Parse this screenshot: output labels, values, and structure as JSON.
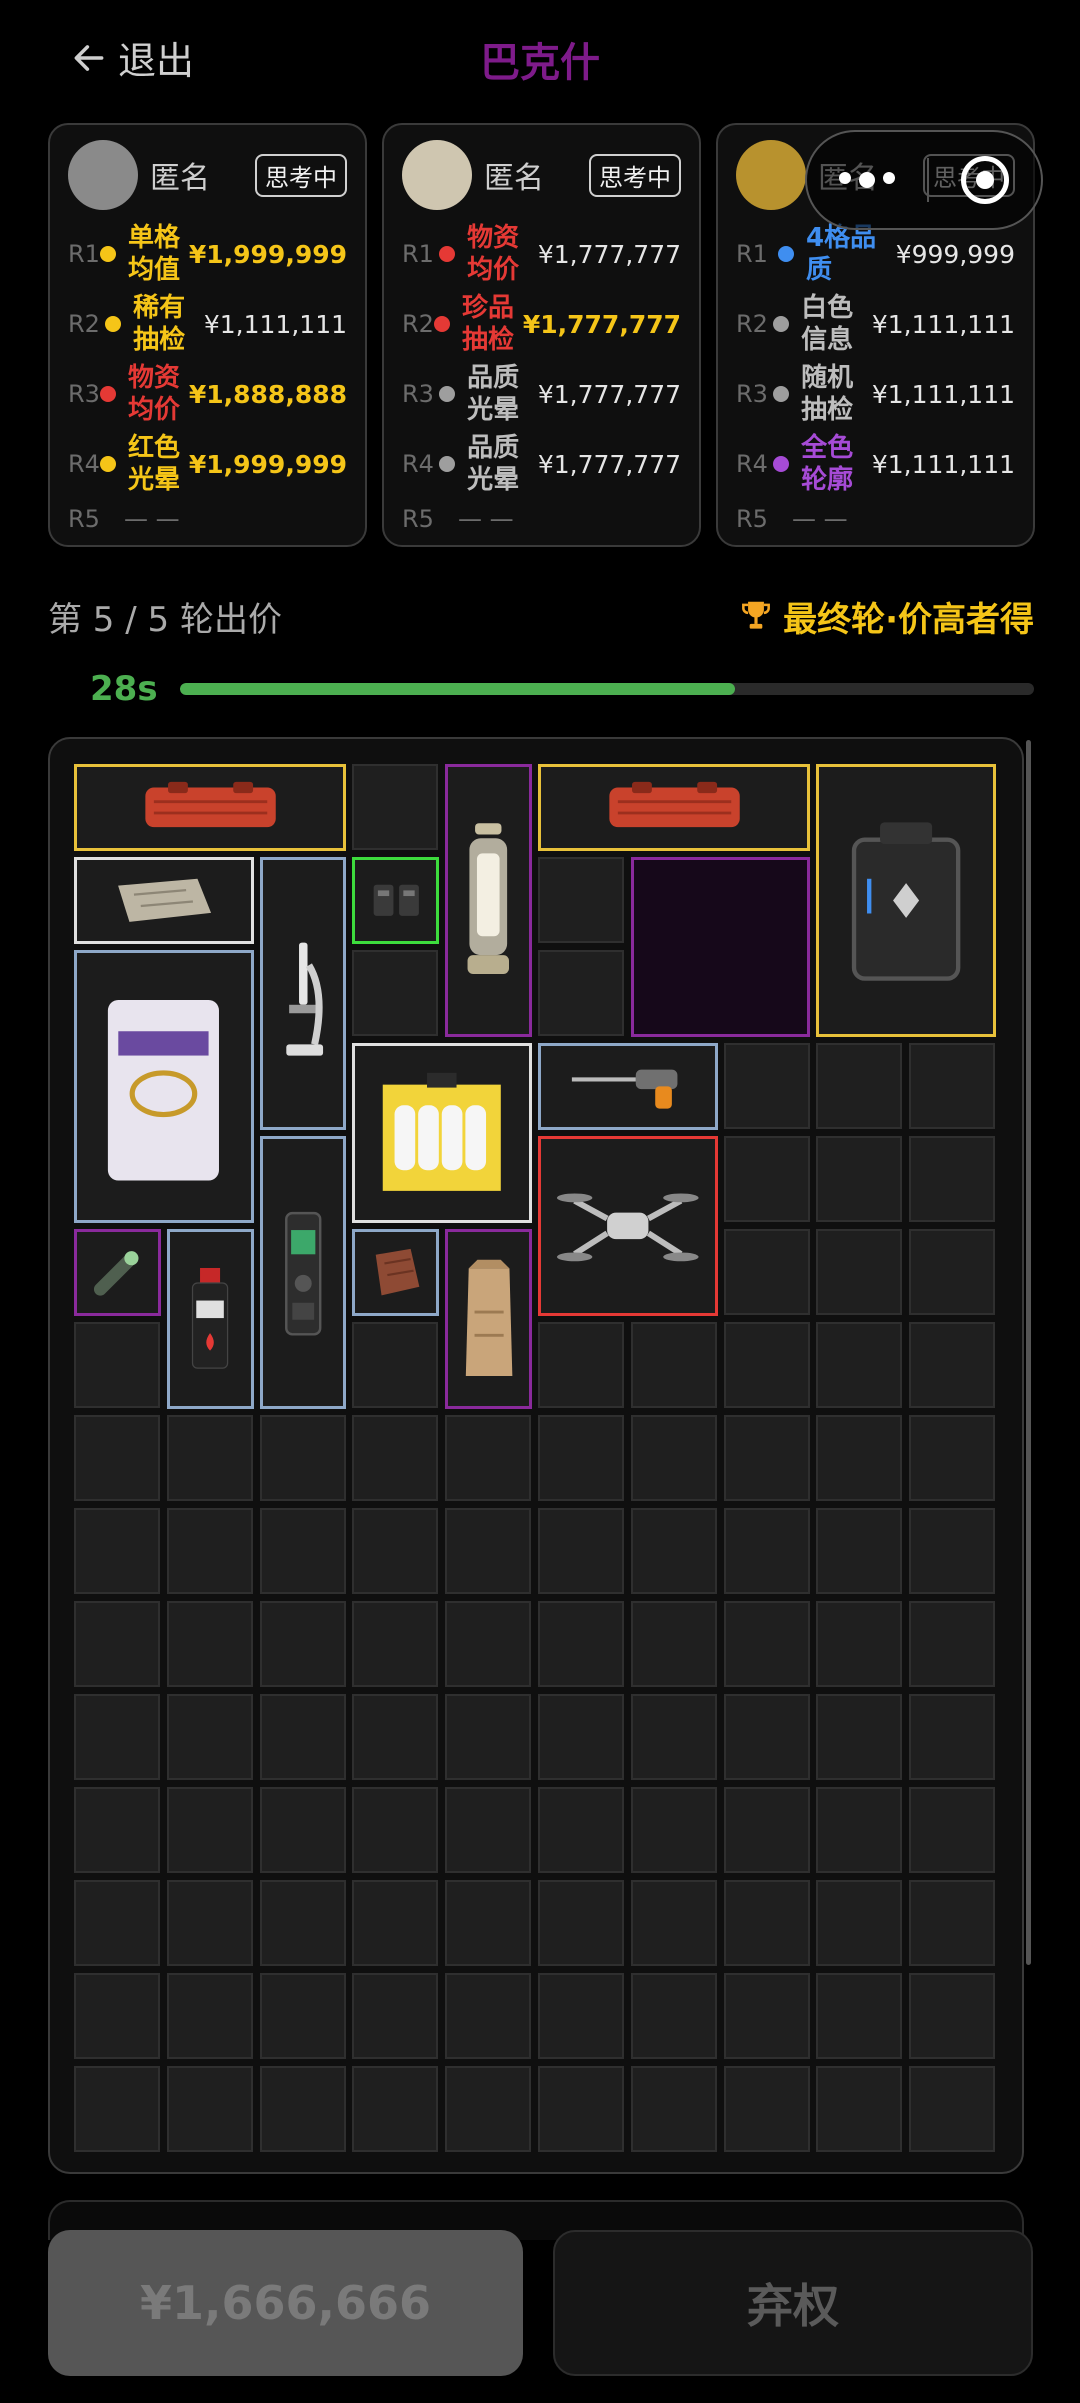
{
  "header": {
    "exit_label": "退出",
    "title": "巴克什",
    "title_color": "#7e1b8a"
  },
  "players": [
    {
      "name": "匿名",
      "status": "思考中",
      "avatar_color": "#8a8a8a",
      "rows": [
        {
          "round": "R1",
          "item": "单格均值",
          "price": "¥1,999,999",
          "dot": "#f5c518",
          "item_color": "#f5c518",
          "highlight": true
        },
        {
          "round": "R2",
          "item": "稀有抽检",
          "price": "¥1,111,111",
          "dot": "#f5c518",
          "item_color": "#f5c518",
          "highlight": false
        },
        {
          "round": "R3",
          "item": "物资均价",
          "price": "¥1,888,888",
          "dot": "#e53935",
          "item_color": "#e53935",
          "highlight": true
        },
        {
          "round": "R4",
          "item": "红色光晕",
          "price": "¥1,999,999",
          "dot": "#f5c518",
          "item_color": "#f5c518",
          "highlight": true
        }
      ],
      "r5": {
        "round": "R5",
        "value": "— —"
      }
    },
    {
      "name": "匿名",
      "status": "思考中",
      "avatar_color": "#cfc6b0",
      "rows": [
        {
          "round": "R1",
          "item": "物资均价",
          "price": "¥1,777,777",
          "dot": "#e53935",
          "item_color": "#e53935",
          "highlight": false
        },
        {
          "round": "R2",
          "item": "珍品抽检",
          "price": "¥1,777,777",
          "dot": "#e53935",
          "item_color": "#e53935",
          "highlight": true
        },
        {
          "round": "R3",
          "item": "品质光晕",
          "price": "¥1,777,777",
          "dot": "#9e9e9e",
          "item_color": "#bdbdbd",
          "highlight": false
        },
        {
          "round": "R4",
          "item": "品质光晕",
          "price": "¥1,777,777",
          "dot": "#9e9e9e",
          "item_color": "#bdbdbd",
          "highlight": false
        }
      ],
      "r5": {
        "round": "R5",
        "value": "— —"
      }
    },
    {
      "name": "匿名",
      "status": "思考中",
      "avatar_color": "#b8922e",
      "rows": [
        {
          "round": "R1",
          "item": "4格品质",
          "price": "¥999,999",
          "dot": "#3f8ef0",
          "item_color": "#3f8ef0",
          "highlight": false
        },
        {
          "round": "R2",
          "item": "白色信息",
          "price": "¥1,111,111",
          "dot": "#9e9e9e",
          "item_color": "#bdbdbd",
          "highlight": false
        },
        {
          "round": "R3",
          "item": "随机抽检",
          "price": "¥1,111,111",
          "dot": "#9e9e9e",
          "item_color": "#bdbdbd",
          "highlight": false
        },
        {
          "round": "R4",
          "item": "全色轮廓",
          "price": "¥1,111,111",
          "dot": "#a64bd6",
          "item_color": "#a64bd6",
          "highlight": false
        }
      ],
      "r5": {
        "round": "R5",
        "value": "— —"
      }
    }
  ],
  "round": {
    "label": "第 5 / 5 轮出价",
    "final_label": "最终轮·价高者得",
    "final_color": "#f5c518"
  },
  "timer": {
    "text": "28s",
    "progress": 0.65,
    "color": "#4caf50"
  },
  "inventory": {
    "items": [
      {
        "name": "orange-case",
        "color": "#e8c13a",
        "icon": "case"
      },
      {
        "name": "orange-case-2",
        "color": "#e8c13a",
        "icon": "case"
      },
      {
        "name": "black-crate",
        "color": "#e8c13a",
        "icon": "crate"
      },
      {
        "name": "lantern",
        "color": "#8a2a9c",
        "icon": "lantern"
      },
      {
        "name": "empty-purple-slot",
        "color": "#8a2a9c",
        "icon": "empty"
      },
      {
        "name": "cloth",
        "color": "#e0e0e0",
        "icon": "cloth"
      },
      {
        "name": "microscope",
        "color": "#8ea8c8",
        "icon": "microscope"
      },
      {
        "name": "battery",
        "color": "#3ddc3d",
        "icon": "battery"
      },
      {
        "name": "cement-bag",
        "color": "#8ea8c8",
        "icon": "bag"
      },
      {
        "name": "candle-box",
        "color": "#e0e0e0",
        "icon": "box"
      },
      {
        "name": "drill",
        "color": "#8ea8c8",
        "icon": "drill"
      },
      {
        "name": "drone",
        "color": "#e53935",
        "icon": "drone"
      },
      {
        "name": "recorder",
        "color": "#8ea8c8",
        "icon": "recorder"
      },
      {
        "name": "flashlight",
        "color": "#8a2a9c",
        "icon": "flashlight"
      },
      {
        "name": "bottle",
        "color": "#8ea8c8",
        "icon": "bottle"
      },
      {
        "name": "leather",
        "color": "#8ea8c8",
        "icon": "leather"
      },
      {
        "name": "paper-bag",
        "color": "#8a2a9c",
        "icon": "paperbag"
      }
    ]
  },
  "actions": {
    "bid_label": "¥1,666,666",
    "pass_label": "弃权"
  }
}
